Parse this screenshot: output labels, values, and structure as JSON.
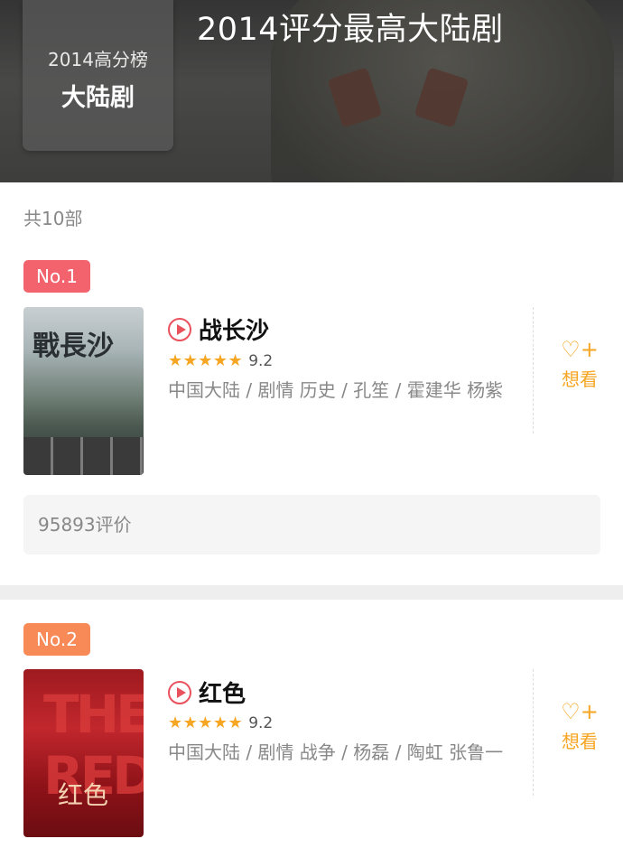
{
  "header": {
    "title": "2014评分最高大陆剧",
    "badge_sub": "2014高分榜",
    "badge_main": "大陆剧"
  },
  "count_label": "共10部",
  "items": [
    {
      "rank": "No.1",
      "name": "战长沙",
      "stars": "★★★★★",
      "score": "9.2",
      "meta": "中国大陆 / 剧情 历史 / 孔笙 / 霍建华 杨紫",
      "want_label": "想看",
      "reviews": "95893评价",
      "poster_text": "戰長沙"
    },
    {
      "rank": "No.2",
      "name": "红色",
      "stars": "★★★★★",
      "score": "9.2",
      "meta": "中国大陆 / 剧情 战争 / 杨磊 / 陶虹 张鲁一",
      "want_label": "想看",
      "poster_text": "THE RED",
      "poster_text_zh": "红色"
    }
  ],
  "colors": {
    "rank1": "#f2636e",
    "rank2": "#f78a57",
    "accent": "#f6a623",
    "play": "#e9515d"
  },
  "icons": {
    "play": "play-circle-icon",
    "want": "heart-plus-icon",
    "star": "star-icon"
  }
}
